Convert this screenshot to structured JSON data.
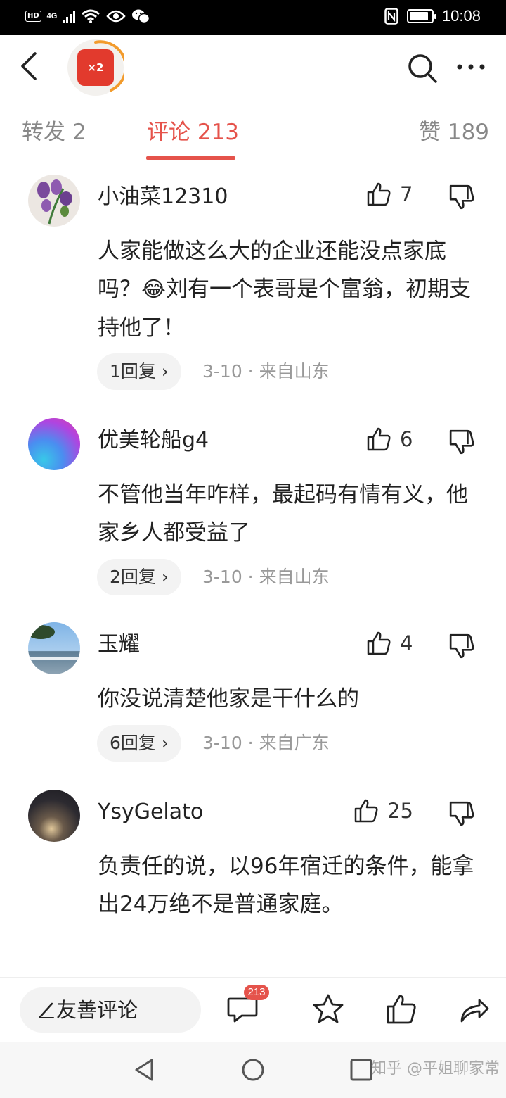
{
  "status_bar": {
    "network_badge": "HD",
    "network_type": "4G",
    "time": "10:08",
    "icons": [
      "signal-icon",
      "wifi-icon",
      "eye-icon",
      "wechat-icon",
      "nfc-icon",
      "battery-icon"
    ]
  },
  "header": {
    "badge_label": "×2",
    "icons": [
      "back-icon",
      "search-icon",
      "more-icon"
    ]
  },
  "tabs": [
    {
      "label": "转发 2",
      "active": false
    },
    {
      "label": "评论 213",
      "active": true
    },
    {
      "label": "赞 189",
      "active": false
    }
  ],
  "comments": [
    {
      "user": "小油菜12310",
      "likes": "7",
      "text_before_emoji": "人家能做这么大的企业还能没点家底吗？",
      "emoji": "😂",
      "text_after_emoji": "刘有一个表哥是个富翁，初期支持他了！",
      "reply_label": "1回复",
      "meta": "3-10 · 来自山东"
    },
    {
      "user": "优美轮船g4",
      "likes": "6",
      "text": "不管他当年咋样，最起码有情有义，他家乡人都受益了",
      "reply_label": "2回复",
      "meta": "3-10 · 来自山东"
    },
    {
      "user": "玉耀",
      "likes": "4",
      "text": "你没说清楚他家是干什么的",
      "reply_label": "6回复",
      "meta": "3-10 · 来自广东"
    },
    {
      "user": "YsyGelato",
      "likes": "25",
      "text": "负责任的说，以96年宿迁的条件，能拿出24万绝不是普通家庭。"
    }
  ],
  "bottom_bar": {
    "input_label": "友善评论",
    "comment_count": "213",
    "icons": [
      "comment-icon",
      "star-icon",
      "thumbs-up-icon",
      "share-icon"
    ]
  },
  "watermark": "知乎 @平姐聊家常",
  "colors": {
    "accent": "#e5534b",
    "muted_text": "#888888",
    "pill_bg": "#f3f3f3"
  }
}
